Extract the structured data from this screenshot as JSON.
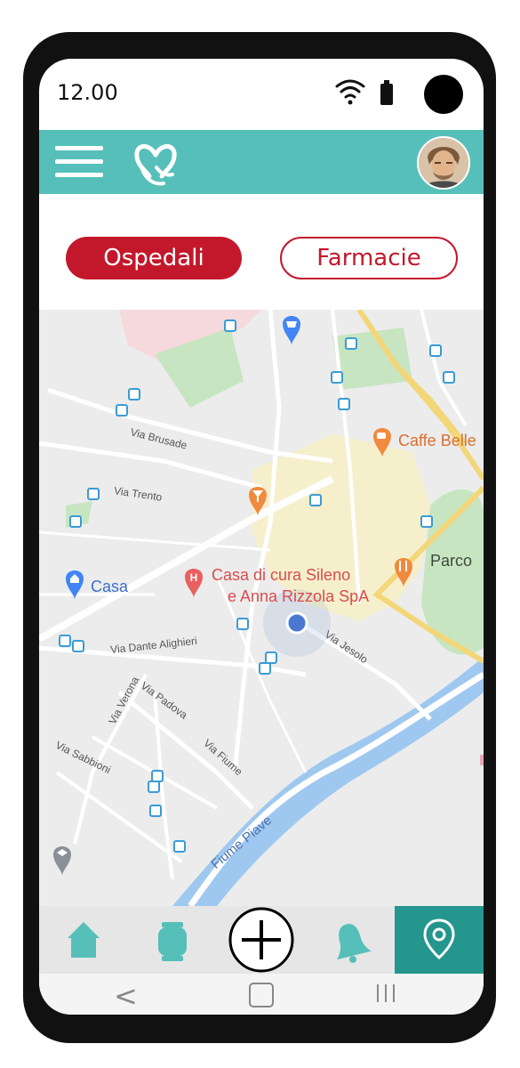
{
  "status_bar": {
    "time": "12.00"
  },
  "header": {
    "menu_icon": "hamburger-menu-icon",
    "logo_icon": "heart-hands-logo-icon",
    "avatar": "user-avatar"
  },
  "filters": {
    "hospitals_label": "Ospedali",
    "pharmacies_label": "Farmacie",
    "active": "Ospedali"
  },
  "map": {
    "streets": {
      "via_brusade": "Via Brusade",
      "via_trento": "Via Trento",
      "via_dante": "Via Dante Alighieri",
      "via_verona": "Via Verona",
      "via_padova": "Via Padova",
      "via_sabbioni": "Via Sabbioni",
      "via_fiume": "Via Fiume",
      "via_jesolo": "Via Jesolo",
      "fiume_piave": "Fiume Piave"
    },
    "pois": {
      "casa": "Casa",
      "hospital_line1": "Casa di cura Sileno",
      "hospital_line2": "e Anna Rizzola SpA",
      "cafe": "Caffe Belle",
      "parco": "Parco"
    },
    "colors": {
      "hospital": "#ea5f5f",
      "food": "#f08a3e",
      "home": "#4285f4",
      "water": "#9fc8f0",
      "park": "#c8e5c2",
      "location": "#4a78d0"
    }
  },
  "bottom_nav": {
    "items": [
      {
        "icon": "home-icon",
        "active": false
      },
      {
        "icon": "smartwatch-icon",
        "active": false
      },
      {
        "icon": "add-circle-icon",
        "active": false
      },
      {
        "icon": "bell-icon",
        "active": false
      },
      {
        "icon": "location-pin-icon",
        "active": true
      }
    ],
    "accent": "#56bfba",
    "active_bg": "#24968e"
  },
  "system_nav": {
    "back": "<",
    "home_icon": "home-square-icon",
    "recents_icon": "recents-icon"
  }
}
